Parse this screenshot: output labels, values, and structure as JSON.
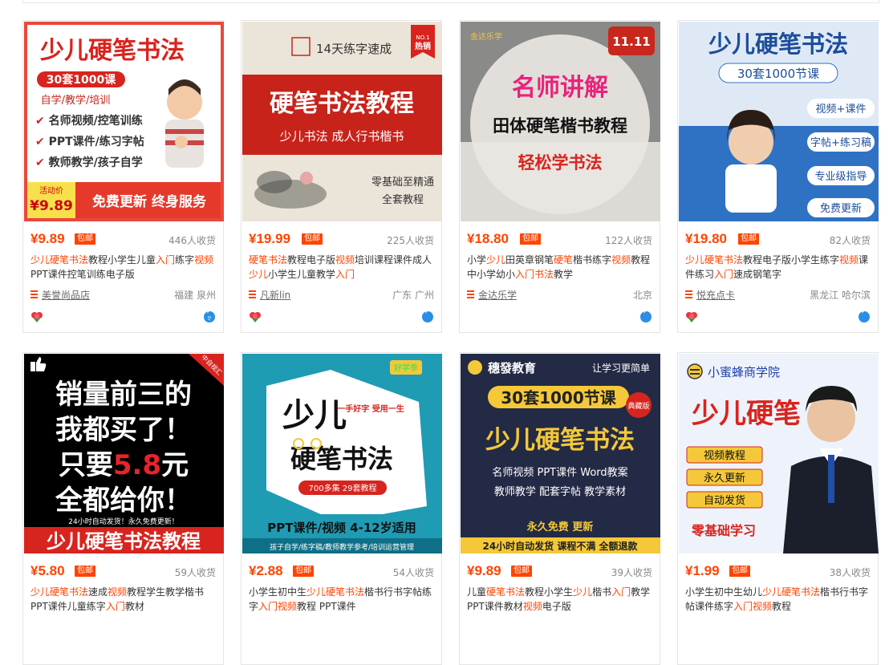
{
  "currency": "¥",
  "baoyou_label": "包邮",
  "items": [
    {
      "price": "9.89",
      "sales": "446人收货",
      "title": [
        [
          "少儿硬笔书法",
          1
        ],
        [
          "教程小学生儿童",
          0
        ],
        [
          "入门",
          1
        ],
        [
          "练字",
          0
        ],
        [
          "视频",
          1
        ],
        [
          "PPT课件控笔训练电子版",
          0
        ]
      ],
      "shop": "美誉尚品店",
      "location": "福建 泉州",
      "image": {
        "headline": "少儿硬笔书法",
        "badge": "30套1000课",
        "sub": "自学/教学/培训",
        "checks": [
          "名师视频/控笔训练",
          "PPT课件/练习字帖",
          "教师教学/孩子自学"
        ],
        "promo": "活动价",
        "promo_price": "¥9.89",
        "footer": "免费更新 终身服务"
      }
    },
    {
      "price": "19.99",
      "sales": "225人收货",
      "title": [
        [
          "硬笔书法",
          1
        ],
        [
          "教程电子版",
          0
        ],
        [
          "视频",
          1
        ],
        [
          "培训课程课件成人",
          0
        ],
        [
          "少儿",
          1
        ],
        [
          "小学生儿童教学",
          0
        ],
        [
          "入门",
          1
        ]
      ],
      "shop": "凡新lin",
      "location": "广东 广州",
      "image": {
        "top": "14天练字速成",
        "corner": "NO.1 热销",
        "headline": "硬笔书法教程",
        "sub": "少儿书法 成人行书楷书",
        "line1": "零基础至精通",
        "line2": "全套教程"
      }
    },
    {
      "price": "18.80",
      "sales": "122人收货",
      "title": [
        [
          "小学",
          0
        ],
        [
          "少儿",
          1
        ],
        [
          "田英章钢笔",
          0
        ],
        [
          "硬笔",
          1
        ],
        [
          "楷书练字",
          0
        ],
        [
          "视频",
          1
        ],
        [
          "教程中小学幼小",
          0
        ],
        [
          "入门",
          1
        ],
        [
          "书法",
          1
        ],
        [
          "教学",
          0
        ]
      ],
      "shop": "金达乐学",
      "location": "北京",
      "image": {
        "brand": "金达乐学",
        "badge": "11.11",
        "line1": "名师讲解",
        "line2": "田体硬笔楷书教程",
        "line3": "轻松学书法"
      }
    },
    {
      "price": "19.80",
      "sales": "82人收货",
      "title": [
        [
          "少儿硬笔书法",
          1
        ],
        [
          "教程电子版小学生练字",
          0
        ],
        [
          "视频",
          1
        ],
        [
          "课件练习",
          0
        ],
        [
          "入门",
          1
        ],
        [
          "速成钢笔字",
          0
        ]
      ],
      "shop": "悦充点卡",
      "location": "黑龙江 哈尔滨",
      "image": {
        "headline": "少儿硬笔书法",
        "badge": "30套1000节课",
        "pills": [
          "视频+课件",
          "字帖+练习稿",
          "专业级指导",
          "免费更新"
        ]
      }
    },
    {
      "price": "5.80",
      "sales": "59人收货",
      "title": [
        [
          "少儿硬笔书法",
          1
        ],
        [
          "速成",
          0
        ],
        [
          "视频",
          1
        ],
        [
          "教程学生教学楷书PPT课件儿童练字",
          0
        ],
        [
          "入门",
          1
        ],
        [
          "教材",
          0
        ]
      ],
      "shop": "",
      "location": "",
      "image": {
        "corner": "中自视汇",
        "l1": "销量前三的",
        "l2": "我都买了！",
        "l3a": "只要",
        "l3b": "5.8",
        "l3c": "元",
        "l4": "全都给你！",
        "strip": "24小时自动发货！永久免费更新！",
        "footer": "少儿硬笔书法教程"
      }
    },
    {
      "price": "2.88",
      "sales": "54人收货",
      "title": [
        [
          "小学生初中生",
          0
        ],
        [
          "少儿硬笔书法",
          1
        ],
        [
          "楷书行书字帖练字",
          0
        ],
        [
          "入门视频",
          1
        ],
        [
          "教程 PPT课件",
          0
        ]
      ],
      "shop": "",
      "location": "",
      "image": {
        "tag": "好学季",
        "big1": "少儿",
        "big2": "硬笔书法",
        "slogan": "一手好字 受用一生",
        "sub": "700多集 29套教程",
        "footer1": "PPT课件/视频  4-12岁适用",
        "footer2": "孩子自学/练字稿/教师教学参考/培训运营管理"
      }
    },
    {
      "price": "9.89",
      "sales": "39人收货",
      "title": [
        [
          "儿童",
          0
        ],
        [
          "硬笔书法",
          1
        ],
        [
          "教程小学生",
          0
        ],
        [
          "少儿",
          1
        ],
        [
          "楷书",
          0
        ],
        [
          "入门",
          1
        ],
        [
          "教学PPT课件教材",
          0
        ],
        [
          "视频",
          1
        ],
        [
          "电子版",
          0
        ]
      ],
      "shop": "",
      "location": "",
      "image": {
        "brand": "穗發教育",
        "slogan": "让学习更简单",
        "badge": "30套1000节课",
        "stamp": "典藏版",
        "headline": "少儿硬笔书法",
        "f1": "名师视频  PPT课件  Word教案",
        "f2": "教师教学  配套字帖  教学素材",
        "free": "永久免费 更新",
        "footer": "24小时自动发货  课程不满  全额退款"
      }
    },
    {
      "price": "1.99",
      "sales": "38人收货",
      "title": [
        [
          "小学生初中生幼儿",
          0
        ],
        [
          "少儿硬笔书法",
          1
        ],
        [
          "楷书行书字帖课件练字",
          0
        ],
        [
          "入门视频",
          1
        ],
        [
          "教程",
          0
        ]
      ],
      "shop": "",
      "location": "",
      "image": {
        "brand": "小蜜蜂商学院",
        "headline": "少儿硬笔",
        "tags": [
          "视频教程",
          "永久更新",
          "自动发货"
        ],
        "footer": "零基础学习"
      }
    }
  ]
}
